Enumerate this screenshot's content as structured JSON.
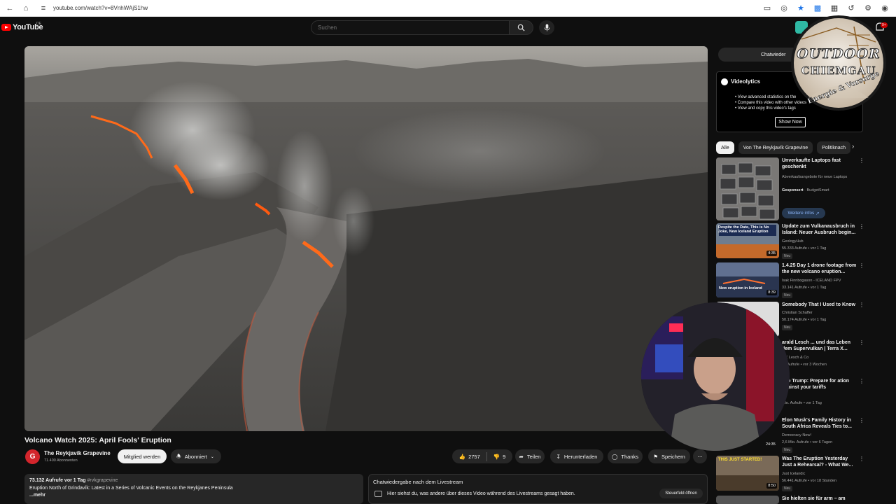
{
  "browser": {
    "url": "youtube.com/watch?v=8VnhWAjS1hw"
  },
  "header": {
    "logo_text": "YouTube",
    "region": "DE",
    "search_placeholder": "Suchen",
    "notification_count": "9+"
  },
  "video": {
    "title": "Volcano Watch 2025: April Fools' Eruption"
  },
  "channel": {
    "avatar_letter": "G",
    "name": "The Reykjavík Grapevine",
    "subscribers": "71.400 Abonnenten",
    "join_label": "Mitglied werden",
    "subscribed_label": "Abonniert"
  },
  "actions": {
    "likes": "2757",
    "dislikes": "9",
    "share": "Teilen",
    "download": "Herunterladen",
    "thanks": "Thanks",
    "save": "Speichern"
  },
  "description": {
    "views_date": "73.132 Aufrufe  vor 1 Tag",
    "hashtag": "#rvkgrapevine",
    "line": "Eruption North of Grindavík: Latest in a Series of Volcanic Events on the Reykjanes Peninsula",
    "more": "...mehr"
  },
  "chat_replay": {
    "title": "Chatwiedergabe nach dem Livestream",
    "text": "Hier siehst du, was andere über dieses Video während des Livestreams gesagt haben.",
    "open_label": "Steuerfeld öffnen",
    "top_label": "Chatwieder"
  },
  "extension": {
    "name": "Videolytics",
    "features": [
      "View advanced statistics on the",
      "Compare this video with other videos",
      "View and copy this video's tags"
    ],
    "button": "Show Now"
  },
  "chips": [
    "Alle",
    "Von The Reykjavík Grapevine",
    "Politiknach"
  ],
  "ad": {
    "title": "Unverkaufte Laptops fast geschenkt",
    "desc": "Abverkaufsangebote für neue Laptops",
    "sponsor": "Gesponsert",
    "advertiser": "BudgetSmart",
    "more_info": "Weitere infos"
  },
  "recommendations": [
    {
      "title": "Update zum Vulkanausbruch in Island: Neuer Ausbruch begin...",
      "channel": "GeologyHub",
      "meta": "55.333 Aufrufe  • vor 1 Tag",
      "badge": "Neu",
      "duration": "4:35",
      "thumb_text": "Despite the Date, This is No Joke, New Iceland Eruption"
    },
    {
      "title": "1.4.25 Day 1 drone footage from the new volcano eruption...",
      "channel": "Isak Finnbogason - ICELAND FPV",
      "meta": "33.141 Aufrufe  • vor 1 Tag",
      "badge": "Neu",
      "duration": "8:39",
      "thumb_text": "New eruption in Iceland"
    },
    {
      "title": "Somebody That I Used to Know",
      "channel": "Christian Schaffer",
      "meta": "50.174 Aufrufe  • vor 1 Tag",
      "badge": "Neu",
      "duration": "",
      "thumb_text": ""
    },
    {
      "title": "arald Lesch ... und das Leben dem Supervulkan | Terra X...",
      "channel": "a X Lesch & Co",
      "meta": "00 Aufrufe  • vor 3 Wochen",
      "badge": "",
      "duration": "",
      "thumb_text": ""
    },
    {
      "title": "e to Trump: Prepare for ation against your tariffs",
      "channel": "",
      "meta": "Mio. Aufrufe  • vor 1 Tag",
      "badge": "",
      "duration": "",
      "thumb_text": ""
    },
    {
      "title": "Elon Musk's Family History in South Africa Reveals Ties to...",
      "channel": "Democracy Now!",
      "meta": "2,6 Mio. Aufrufe  • vor 6 Tagen",
      "badge": "Neu",
      "duration": "24:35",
      "thumb_text": ""
    },
    {
      "title": "Was The Eruption Yesterday Just a Rehearsal? - What We...",
      "channel": "Just Icelandic",
      "meta": "56.441 Aufrufe  • vor 18 Stunden",
      "badge": "Neu",
      "duration": "8:50",
      "thumb_text": "THIS JUST STARTED!"
    },
    {
      "title": "Sie hielten sie für arm – am",
      "channel": "",
      "meta": "",
      "badge": "",
      "duration": "",
      "thumb_text": ""
    }
  ],
  "overlay": {
    "badge_line1": "OUTDOOR",
    "badge_line2": "CHIEMGAU",
    "badge_line3": "Energie & Vorsorge"
  }
}
